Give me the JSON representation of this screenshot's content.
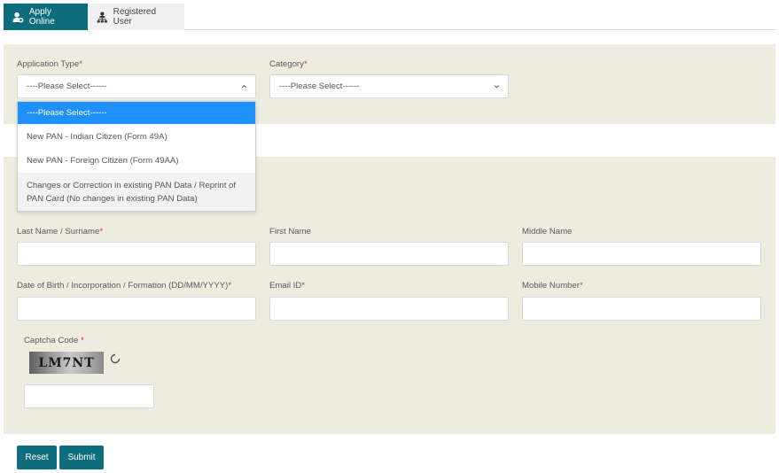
{
  "tabs": {
    "apply_online": {
      "label": "Apply Online",
      "icon": "user-plus-icon",
      "active": true
    },
    "registered_user": {
      "label": "Registered User",
      "icon": "user-sitemap-icon",
      "active": false
    }
  },
  "form": {
    "application_type": {
      "label": "Application Type",
      "value": "----Please Select------",
      "options": [
        "----Please Select------",
        "New PAN - Indian Citizen (Form 49A)",
        "New PAN - Foreign Citizen (Form 49AA)",
        "Changes or Correction in existing PAN Data / Reprint of PAN Card (No changes in existing PAN Data)"
      ]
    },
    "category": {
      "label": "Category",
      "value": "----Please Select------"
    },
    "last_name": {
      "label": "Last Name / Surname"
    },
    "first_name": {
      "label": "First Name"
    },
    "middle_name": {
      "label": "Middle Name"
    },
    "dob": {
      "label": "Date of Birth / Incorporation / Formation (DD/MM/YYYY)"
    },
    "email": {
      "label": "Email ID"
    },
    "mobile": {
      "label": "Mobile Number"
    },
    "captcha": {
      "label": "Captcha Code",
      "image_text": "LM7NT"
    },
    "required_mark": "*"
  },
  "buttons": {
    "reset": "Reset",
    "submit": "Submit"
  },
  "colors": {
    "primary": "#0e6d7c",
    "panel_bg": "#edecdf",
    "dropdown_selected": "#1e90ff",
    "required": "#c0392b"
  }
}
